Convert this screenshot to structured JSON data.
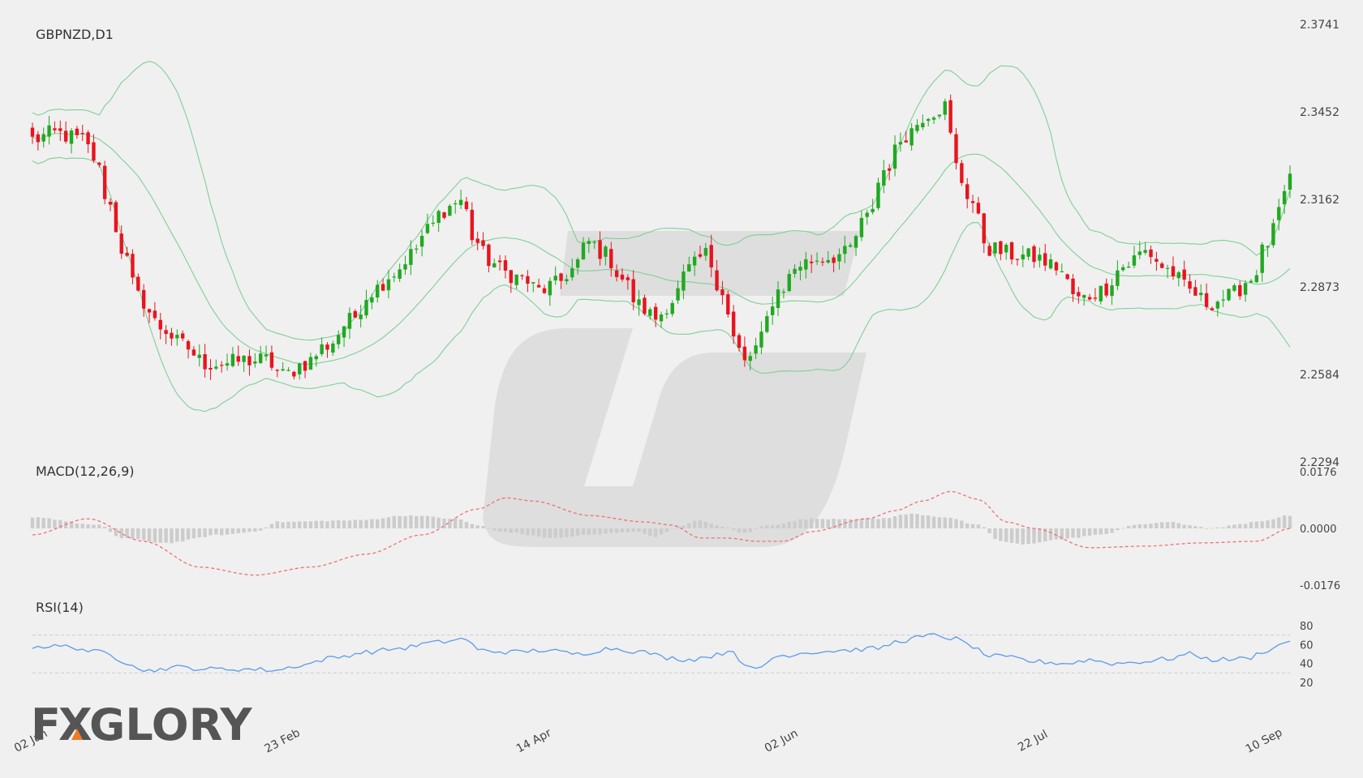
{
  "colors": {
    "background": "#f0f0f0",
    "bull": "#21a821",
    "bear": "#e8141e",
    "bollinger": "#7fcf95",
    "macd_line": "#f07070",
    "macd_hist": "#cccccc",
    "rsi_line": "#5b9bea",
    "rsi_levels": "#cccccc",
    "logo_text": "#555555",
    "logo_accent": "#f07b24"
  },
  "logo": {
    "prefix": "F",
    "middle": "X",
    "suffix": "GLORY",
    "accent": "triangle"
  },
  "chart_data": [
    {
      "type": "candlestick",
      "title": "GBPNZD,D1",
      "overlay": "bollinger-bands",
      "ylim": [
        2.2294,
        2.3741
      ],
      "y_ticks": [
        "2.3741",
        "2.3452",
        "2.3162",
        "2.2873",
        "2.2584",
        "2.2294"
      ],
      "x_ticks": [
        "02 Jan",
        "23 Feb",
        "14 Apr",
        "02 Jun",
        "22 Jul",
        "10 Sep"
      ],
      "anchors": [
        [
          0,
          2.336
        ],
        [
          4,
          2.338
        ],
        [
          9,
          2.336
        ],
        [
          11,
          2.33
        ],
        [
          14,
          2.314
        ],
        [
          16,
          2.3
        ],
        [
          19,
          2.284
        ],
        [
          23,
          2.274
        ],
        [
          27,
          2.268
        ],
        [
          31,
          2.262
        ],
        [
          35,
          2.262
        ],
        [
          38,
          2.263
        ],
        [
          42,
          2.263
        ],
        [
          45,
          2.258
        ],
        [
          49,
          2.262
        ],
        [
          53,
          2.268
        ],
        [
          57,
          2.276
        ],
        [
          61,
          2.286
        ],
        [
          65,
          2.292
        ],
        [
          68,
          2.298
        ],
        [
          71,
          2.306
        ],
        [
          74,
          2.313
        ],
        [
          77,
          2.316
        ],
        [
          78,
          2.312
        ],
        [
          79,
          2.304
        ],
        [
          82,
          2.296
        ],
        [
          85,
          2.292
        ],
        [
          88,
          2.29
        ],
        [
          91,
          2.286
        ],
        [
          94,
          2.288
        ],
        [
          97,
          2.293
        ],
        [
          100,
          2.302
        ],
        [
          103,
          2.298
        ],
        [
          106,
          2.29
        ],
        [
          109,
          2.281
        ],
        [
          112,
          2.277
        ],
        [
          115,
          2.283
        ],
        [
          118,
          2.293
        ],
        [
          121,
          2.298
        ],
        [
          124,
          2.286
        ],
        [
          126,
          2.27
        ],
        [
          128,
          2.262
        ],
        [
          130,
          2.267
        ],
        [
          134,
          2.286
        ],
        [
          138,
          2.295
        ],
        [
          142,
          2.297
        ],
        [
          146,
          2.298
        ],
        [
          150,
          2.31
        ],
        [
          153,
          2.326
        ],
        [
          157,
          2.338
        ],
        [
          161,
          2.345
        ],
        [
          164,
          2.347
        ],
        [
          166,
          2.327
        ],
        [
          168,
          2.318
        ],
        [
          172,
          2.3
        ],
        [
          176,
          2.298
        ],
        [
          180,
          2.297
        ],
        [
          184,
          2.294
        ],
        [
          188,
          2.283
        ],
        [
          192,
          2.286
        ],
        [
          196,
          2.294
        ],
        [
          200,
          2.299
        ],
        [
          204,
          2.293
        ],
        [
          208,
          2.286
        ],
        [
          211,
          2.282
        ],
        [
          215,
          2.284
        ],
        [
          219,
          2.29
        ],
        [
          222,
          2.302
        ],
        [
          225,
          2.316
        ],
        [
          226,
          2.323
        ]
      ]
    },
    {
      "type": "line",
      "title": "MACD(12,26,9)",
      "series": [
        {
          "name": "",
          "style": "dashed-signal"
        },
        {
          "name": "",
          "style": "histogram"
        }
      ],
      "ylim": [
        -0.0176,
        0.0176
      ],
      "y_ticks": [
        "0.0176",
        "0.0000",
        "-0.0176"
      ],
      "signal_anchors": [
        [
          0,
          -0.002
        ],
        [
          10,
          0.003
        ],
        [
          20,
          -0.004
        ],
        [
          30,
          -0.012
        ],
        [
          40,
          -0.0145
        ],
        [
          50,
          -0.012
        ],
        [
          60,
          -0.008
        ],
        [
          70,
          -0.002
        ],
        [
          80,
          0.006
        ],
        [
          85,
          0.0095
        ],
        [
          90,
          0.0085
        ],
        [
          100,
          0.004
        ],
        [
          110,
          0.002
        ],
        [
          115,
          0.001
        ],
        [
          120,
          -0.003
        ],
        [
          125,
          -0.003
        ],
        [
          130,
          -0.004
        ],
        [
          135,
          -0.004
        ],
        [
          140,
          -0.001
        ],
        [
          150,
          0.003
        ],
        [
          155,
          0.0055
        ],
        [
          160,
          0.0085
        ],
        [
          165,
          0.0115
        ],
        [
          170,
          0.009
        ],
        [
          175,
          0.002
        ],
        [
          180,
          0.0
        ],
        [
          190,
          -0.006
        ],
        [
          200,
          -0.0055
        ],
        [
          210,
          -0.0045
        ],
        [
          220,
          -0.004
        ],
        [
          226,
          0.0
        ]
      ],
      "hist_anchors": [
        [
          0,
          0.0035
        ],
        [
          12,
          0.001
        ],
        [
          16,
          -0.003
        ],
        [
          24,
          -0.0045
        ],
        [
          34,
          -0.002
        ],
        [
          40,
          -0.001
        ],
        [
          44,
          0.002
        ],
        [
          58,
          0.0025
        ],
        [
          68,
          0.004
        ],
        [
          76,
          0.003
        ],
        [
          80,
          0.001
        ],
        [
          84,
          -0.001
        ],
        [
          94,
          -0.003
        ],
        [
          100,
          -0.002
        ],
        [
          108,
          -0.001
        ],
        [
          112,
          -0.0025
        ],
        [
          116,
          0.0005
        ],
        [
          120,
          0.0025
        ],
        [
          124,
          0.0005
        ],
        [
          128,
          -0.0015
        ],
        [
          132,
          0.001
        ],
        [
          140,
          0.003
        ],
        [
          152,
          0.003
        ],
        [
          158,
          0.0045
        ],
        [
          164,
          0.0035
        ],
        [
          170,
          0.001
        ],
        [
          174,
          -0.004
        ],
        [
          178,
          -0.005
        ],
        [
          184,
          -0.0035
        ],
        [
          192,
          -0.002
        ],
        [
          198,
          0.001
        ],
        [
          204,
          0.002
        ],
        [
          208,
          0.001
        ],
        [
          212,
          0.0
        ],
        [
          216,
          0.001
        ],
        [
          220,
          0.002
        ],
        [
          226,
          0.004
        ]
      ]
    },
    {
      "type": "line",
      "title": "RSI(14)",
      "series": [
        {
          "name": ""
        }
      ],
      "ylim": [
        20,
        80
      ],
      "y_ticks": [
        "80",
        "60",
        "40",
        "20"
      ],
      "levels": [
        70,
        30
      ],
      "anchors": [
        [
          0,
          58
        ],
        [
          6,
          58
        ],
        [
          12,
          52
        ],
        [
          18,
          40
        ],
        [
          20,
          32
        ],
        [
          26,
          36
        ],
        [
          32,
          34
        ],
        [
          38,
          34
        ],
        [
          44,
          33
        ],
        [
          48,
          38
        ],
        [
          54,
          46
        ],
        [
          60,
          52
        ],
        [
          66,
          56
        ],
        [
          72,
          62
        ],
        [
          78,
          66
        ],
        [
          80,
          54
        ],
        [
          86,
          52
        ],
        [
          92,
          54
        ],
        [
          98,
          50
        ],
        [
          104,
          56
        ],
        [
          110,
          52
        ],
        [
          114,
          46
        ],
        [
          118,
          44
        ],
        [
          122,
          48
        ],
        [
          126,
          54
        ],
        [
          128,
          36
        ],
        [
          130,
          34
        ],
        [
          134,
          48
        ],
        [
          140,
          52
        ],
        [
          146,
          54
        ],
        [
          152,
          56
        ],
        [
          156,
          64
        ],
        [
          160,
          68
        ],
        [
          162,
          70
        ],
        [
          166,
          66
        ],
        [
          168,
          60
        ],
        [
          172,
          48
        ],
        [
          176,
          46
        ],
        [
          180,
          42
        ],
        [
          186,
          40
        ],
        [
          190,
          44
        ],
        [
          194,
          40
        ],
        [
          200,
          42
        ],
        [
          204,
          45
        ],
        [
          208,
          50
        ],
        [
          212,
          44
        ],
        [
          218,
          45
        ],
        [
          222,
          54
        ],
        [
          226,
          64
        ]
      ]
    }
  ]
}
